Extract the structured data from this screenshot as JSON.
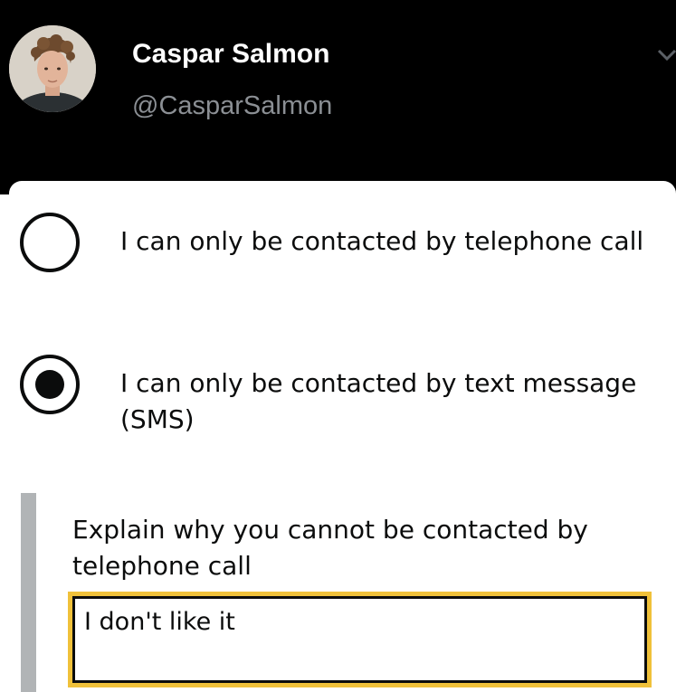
{
  "tweet_header": {
    "display_name": "Caspar Salmon",
    "handle": "@CasparSalmon",
    "menu_icon": "chevron-down-icon"
  },
  "form": {
    "options": [
      {
        "label": "I can only be contacted by telephone call",
        "selected": false
      },
      {
        "label": "I can only be contacted by text message (SMS)",
        "selected": true
      }
    ],
    "explain_label": "Explain why you cannot be contacted by telephone call",
    "explain_value": "I don't like it"
  },
  "colors": {
    "header_background": "#000000",
    "focus_outline": "#f0c13a",
    "conditional_border": "#b1b4b6",
    "text": "#0b0c0c"
  }
}
